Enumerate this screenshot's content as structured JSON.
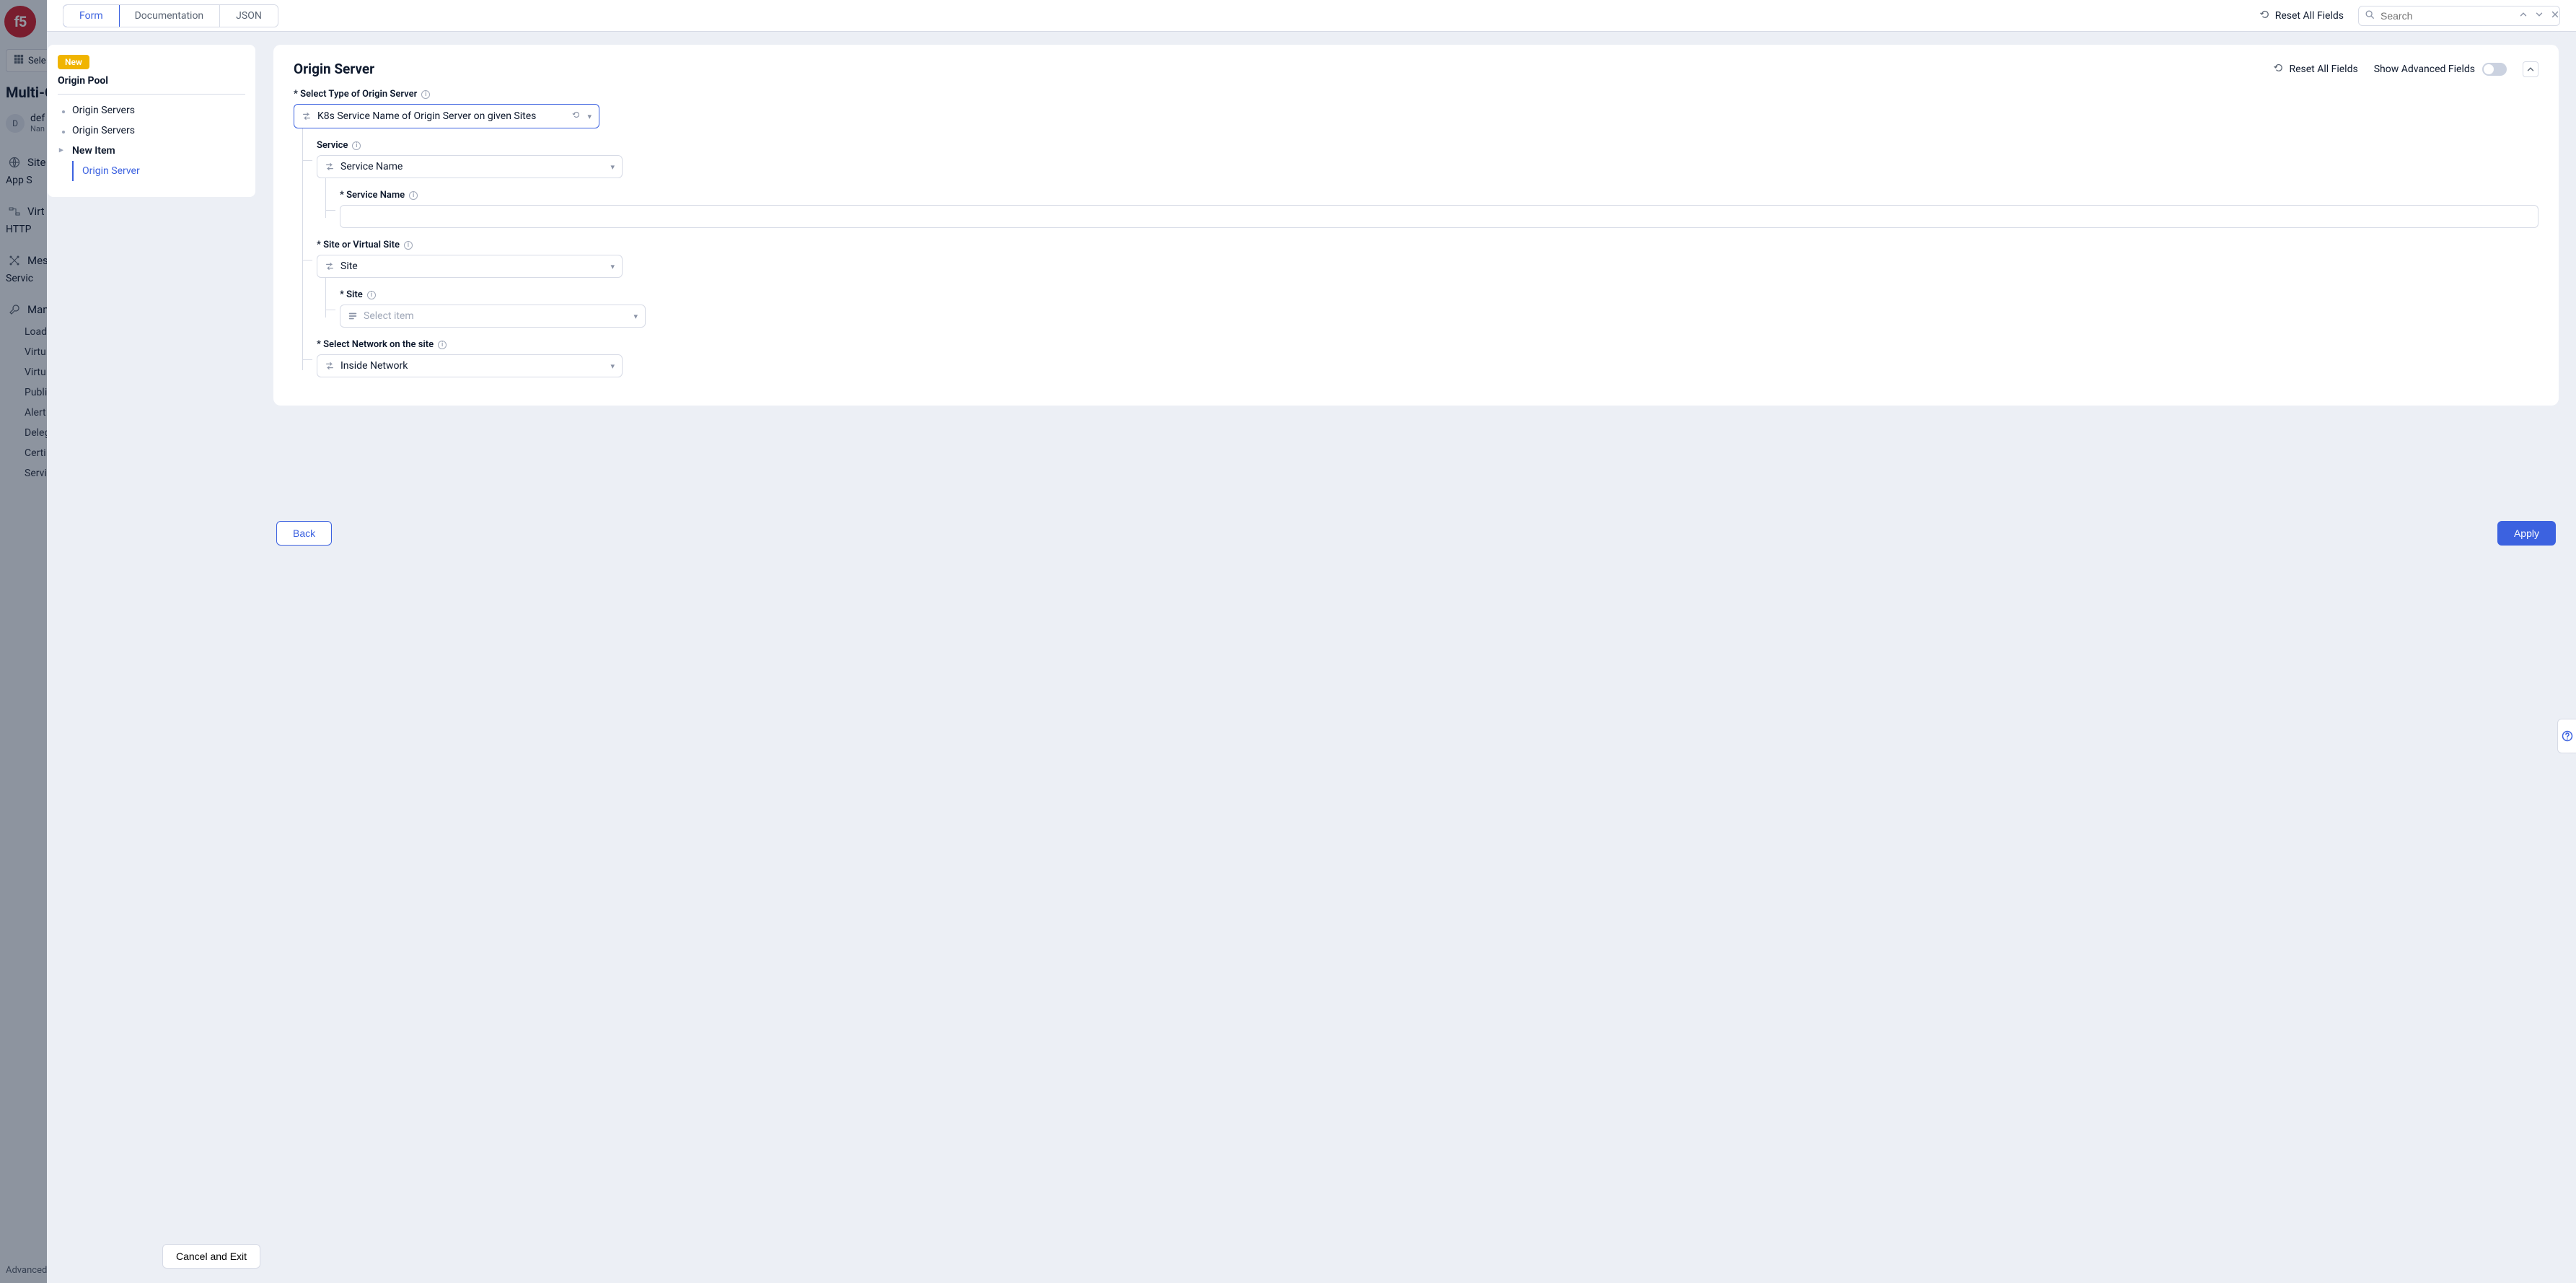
{
  "bg": {
    "logo_text": "f5",
    "select_service": "Sele",
    "title": "Multi-C",
    "namespace": {
      "initial": "D",
      "name": "def",
      "sub": "Nan"
    },
    "nav": {
      "sites": {
        "label": "Site",
        "sub": "App S"
      },
      "virtual": {
        "label": "Virt",
        "sub": "HTTP"
      },
      "mesh": {
        "label": "Mes",
        "sub": "Servic"
      },
      "manage": {
        "label": "Man"
      },
      "sub_items": [
        "Load",
        "Virtu",
        "Virtu",
        "Publi",
        "Alert",
        "Deleg Mana",
        "Certi",
        "Servi"
      ]
    },
    "advanced": "Advanced"
  },
  "top": {
    "tabs": {
      "form": "Form",
      "documentation": "Documentation",
      "json": "JSON"
    },
    "reset_all": "Reset All Fields",
    "search_placeholder": "Search"
  },
  "tree": {
    "badge": "New",
    "title": "Origin Pool",
    "items": {
      "l1a": "Origin Servers",
      "l1b": "Origin Servers",
      "new_item": "New Item",
      "child": "Origin Server"
    }
  },
  "form": {
    "title": "Origin Server",
    "reset_all": "Reset All Fields",
    "show_advanced": "Show Advanced Fields",
    "type_label": "Select Type of Origin Server",
    "type_value": "K8s Service Name of Origin Server on given Sites",
    "service_label": "Service",
    "service_value": "Service Name",
    "service_name_label": "Service Name",
    "service_name_value": "",
    "site_vsite_label": "Site or Virtual Site",
    "site_vsite_value": "Site",
    "site_label": "Site",
    "site_placeholder": "Select item",
    "network_label": "Select Network on the site",
    "network_value": "Inside Network"
  },
  "footer": {
    "cancel_exit": "Cancel and Exit",
    "back": "Back",
    "apply": "Apply"
  }
}
